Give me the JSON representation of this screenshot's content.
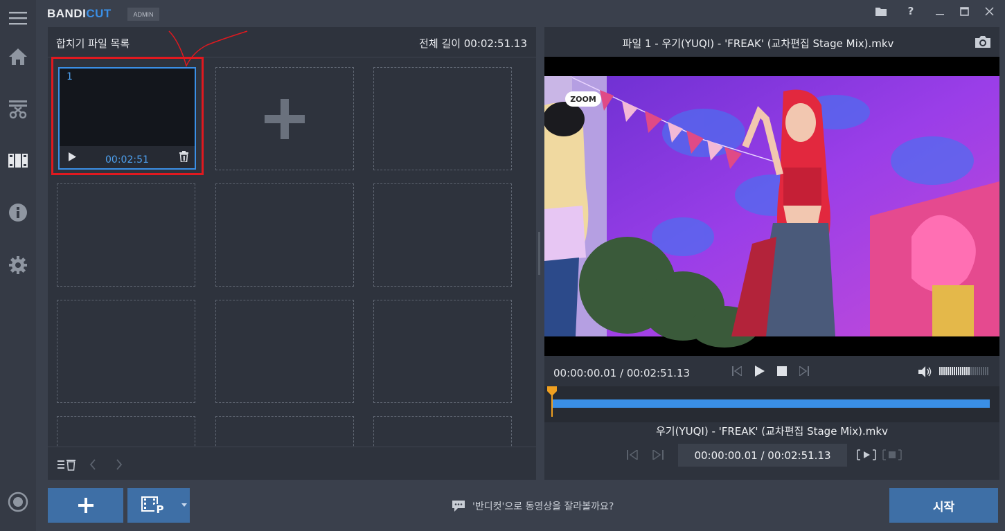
{
  "app": {
    "logo_main": "BANDI",
    "logo_accent": "CUT",
    "badge": "ADMIN"
  },
  "sidebar": {
    "items": [
      {
        "name": "menu"
      },
      {
        "name": "home"
      },
      {
        "name": "cut"
      },
      {
        "name": "merge"
      },
      {
        "name": "info"
      },
      {
        "name": "settings"
      },
      {
        "name": "record"
      }
    ]
  },
  "left_panel": {
    "title": "합치기 파일 목록",
    "total_length": "전체 길이 00:02:51.13",
    "clips": [
      {
        "index": "1",
        "duration": "00:02:51"
      }
    ]
  },
  "right_panel": {
    "title": "파일 1 - 우기(YUQI) - 'FREAK' (교차편집 Stage Mix).mkv",
    "current_time": "00:00:00.01 / 00:02:51.13",
    "file_name": "우기(YUQI) - 'FREAK' (교차편집 Stage Mix).mkv",
    "segment_time": "00:00:00.01 / 00:02:51.13",
    "video_overlay_text": "ZOOM",
    "volume_level": 0.62,
    "progress": 0.0
  },
  "bottom": {
    "hint": "'반디컷'으로 동영상을 잘라볼까요?",
    "start_label": "시작"
  },
  "colors": {
    "accent": "#3a8fe6",
    "highlight": "#e0191f",
    "panel": "#2e333d",
    "background": "#3a404c",
    "playhead": "#f0a020"
  }
}
